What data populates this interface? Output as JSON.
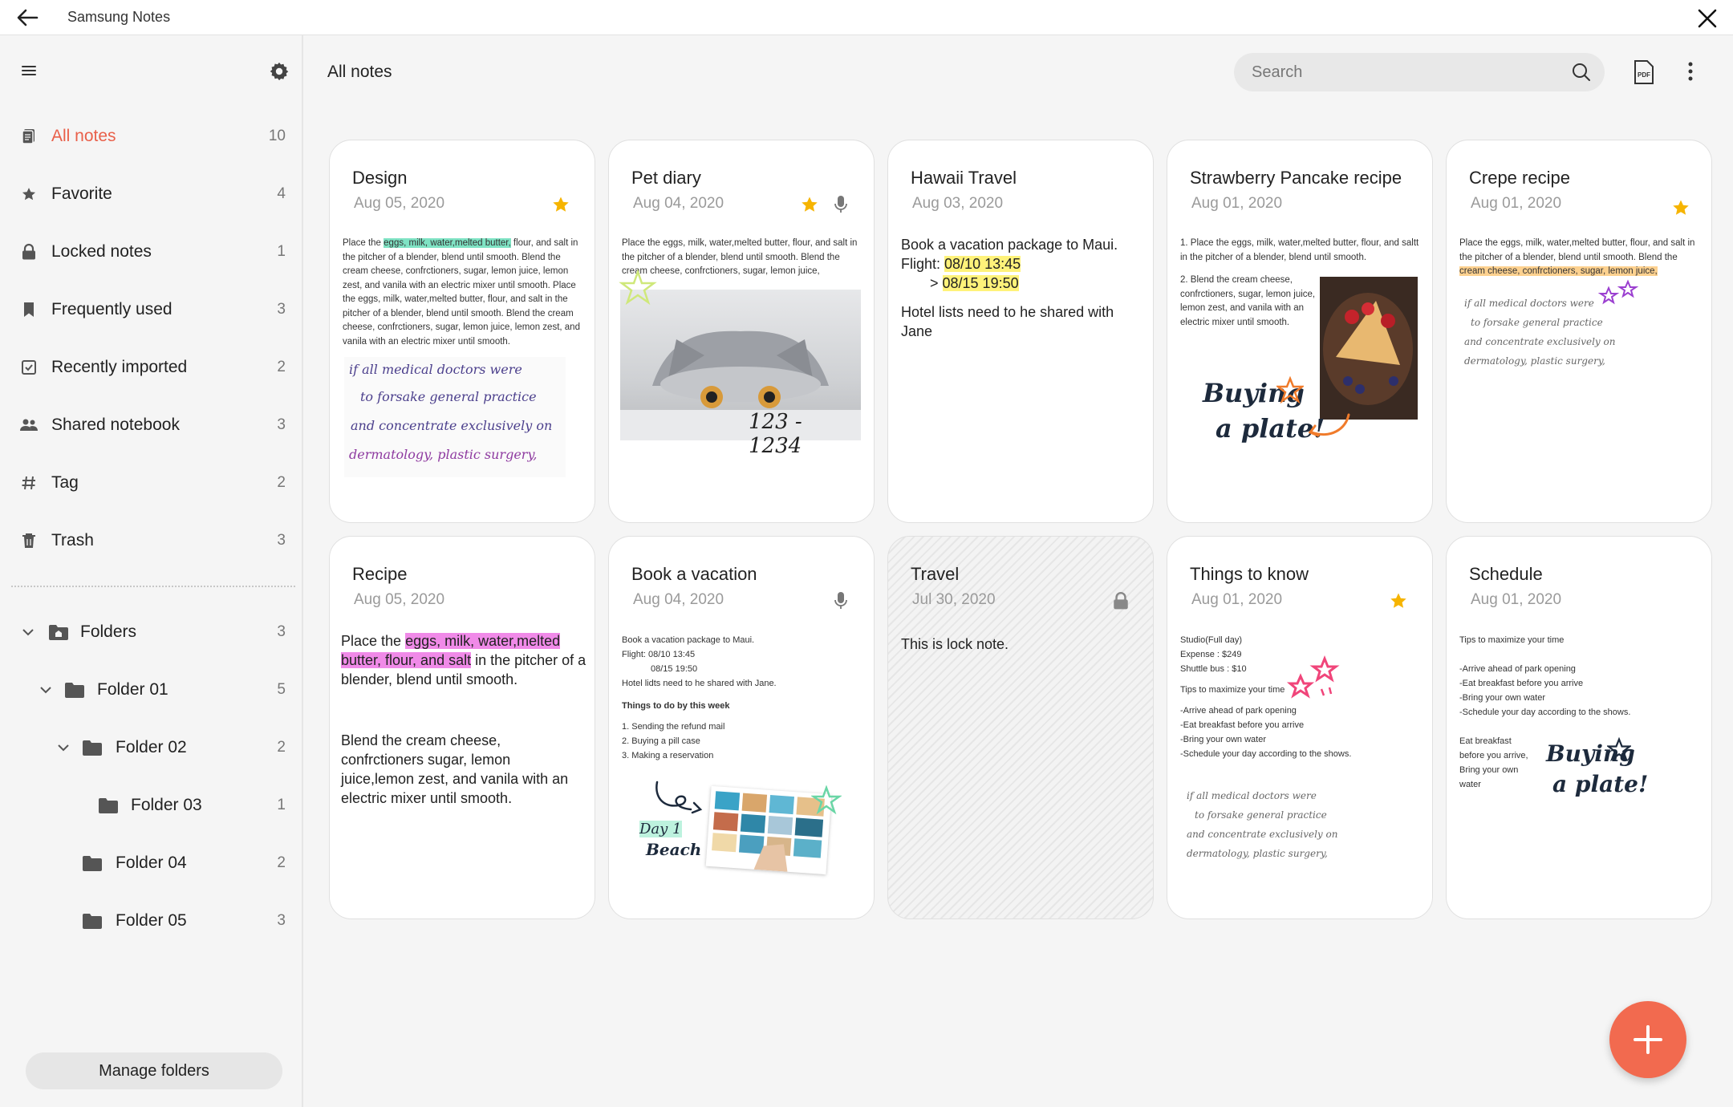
{
  "titlebar": {
    "app_title": "Samsung Notes"
  },
  "sidebar": {
    "items": [
      {
        "label": "All notes",
        "count": "10",
        "icon": "all-notes-icon"
      },
      {
        "label": "Favorite",
        "count": "4",
        "icon": "star-icon"
      },
      {
        "label": "Locked notes",
        "count": "1",
        "icon": "lock-icon"
      },
      {
        "label": "Frequently used",
        "count": "3",
        "icon": "bookmark-icon"
      },
      {
        "label": "Recently imported",
        "count": "2",
        "icon": "import-icon"
      },
      {
        "label": "Shared notebook",
        "count": "3",
        "icon": "people-icon"
      },
      {
        "label": "Tag",
        "count": "2",
        "icon": "hash-icon"
      },
      {
        "label": "Trash",
        "count": "3",
        "icon": "trash-icon"
      }
    ],
    "folders": [
      {
        "label": "Folders",
        "count": "3"
      },
      {
        "label": "Folder 01",
        "count": "5"
      },
      {
        "label": "Folder 02",
        "count": "2"
      },
      {
        "label": "Folder 03",
        "count": "1"
      },
      {
        "label": "Folder 04",
        "count": "2"
      },
      {
        "label": "Folder 05",
        "count": "3"
      }
    ],
    "manage_label": "Manage folders"
  },
  "header": {
    "title": "All notes",
    "search_placeholder": "Search"
  },
  "notes": [
    {
      "title": "Design",
      "date": "Aug 05, 2020"
    },
    {
      "title": "Pet diary",
      "date": "Aug 04, 2020"
    },
    {
      "title": "Hawaii Travel",
      "date": "Aug 03, 2020"
    },
    {
      "title": "Strawberry Pancake recipe",
      "date": "Aug 01, 2020"
    },
    {
      "title": "Crepe recipe",
      "date": "Aug 01, 2020"
    },
    {
      "title": "Recipe",
      "date": "Aug 05, 2020"
    },
    {
      "title": "Book a vacation",
      "date": "Aug 04, 2020"
    },
    {
      "title": "Travel",
      "date": "Jul 30, 2020"
    },
    {
      "title": "Things to know",
      "date": "Aug 01, 2020"
    },
    {
      "title": "Schedule",
      "date": "Aug 01, 2020"
    }
  ],
  "content": {
    "design": {
      "pre": "Place the ",
      "hl": "eggs, milk, water,melted butter,",
      "post": " flour, and salt in the pitcher of a blender, blend until smooth. Blend the cream cheese, confrctioners, sugar, lemon juice, lemon zest, and vanila with an electric mixer until smooth. Place the eggs, milk, water,melted butter, flour, and salt in the pitcher of a blender, blend until smooth. Blend the cream cheese, confrctioners, sugar, lemon juice, lemon zest, and vanila with an electric mixer until smooth.",
      "hand1": "if all medical doctors were",
      "hand2": "to forsake general practice",
      "hand3": "and concentrate exclusively on",
      "hand4": "dermatology, plastic surgery,"
    },
    "pet": {
      "text": "Place the eggs, milk, water,melted butter, flour, and salt in the pitcher of a blender, blend until smooth. Blend the cream cheese, confrctioners, sugar, lemon juice,",
      "hand": "123 - 1234"
    },
    "hawaii": {
      "line1": "Book a vacation package to Maui.",
      "flight_label": "Flight: ",
      "flight1": "08/10 13:45",
      "arrow": "> ",
      "flight2": "08/15 19:50",
      "line3": "Hotel lists need to he shared with Jane"
    },
    "strawberry": {
      "p1": "1. Place the eggs, milk, water,melted butter, flour, and saltt in the pitcher of a blender, blend until smooth.",
      "p2": "2. Blend the cream cheese, confrctioners, sugar, lemon juice, lemon zest, and vanila with an electric mixer until smooth.",
      "hand1": "Buying",
      "hand2": "a plate!"
    },
    "crepe": {
      "pre": "Place the eggs, milk, water,melted butter, flour, and salt in the pitcher of a blender, blend until smooth. Blend the ",
      "hl": "cream cheese, confrctioners, sugar, lemon juice,",
      "hand1": "if all medical doctors were",
      "hand2": "to forsake general practice",
      "hand3": "and concentrate exclusively on",
      "hand4": "dermatology, plastic surgery,"
    },
    "recipe": {
      "pre": "Place the ",
      "hl": "eggs, milk, water,melted butter, flour, and salt",
      "post": " in the pitcher of a blender, blend until smooth.",
      "p2": "Blend the cream cheese, confrctioners sugar, lemon juice,lemon zest, and vanila with an electric mixer until smooth."
    },
    "vacation": {
      "l1": "Book a vacation package to Maui.",
      "l2": "Flight: 08/10 13:45",
      "l3": "08/15 19:50",
      "l4": "Hotel lidts need to he shared with Jane.",
      "todo_title": "Things to do by this week",
      "t1": "1. Sending the refund mail",
      "t2": "2. Buying a pill case",
      "t3": "3. Making a reservation",
      "hand1": "Day 1",
      "hand2": "Beach"
    },
    "travel": {
      "text": "This is lock note."
    },
    "things": {
      "l1": "Studio(Full day)",
      "l2": "Expense : $249",
      "l3": "Shuttle bus : $10",
      "l4": "Tips to maximize your time",
      "l5": "-Arrive ahead of park opening",
      "l6": "-Eat breakfast before you arrive",
      "l7": "-Bring your own water",
      "l8": "-Schedule your day according to the shows.",
      "hand1": "if all medical doctors were",
      "hand2": "to forsake general practice",
      "hand3": "and concentrate exclusively on",
      "hand4": "dermatology, plastic surgery,"
    },
    "schedule": {
      "l1": "Tips to maximize your time",
      "l2": "-Arrive ahead of park opening",
      "l3": "-Eat breakfast before you arrive",
      "l4": "-Bring your own water",
      "l5": "-Schedule your day according to the shows.",
      "l6": "Eat breakfast",
      "l7": "before you arrive,",
      "l8": "Bring your own",
      "l9": "water",
      "hand1": "Buying",
      "hand2": "a plate!"
    }
  },
  "colors": {
    "accent": "#e9604a",
    "fab": "#f26a4f",
    "star": "#f6b400"
  }
}
